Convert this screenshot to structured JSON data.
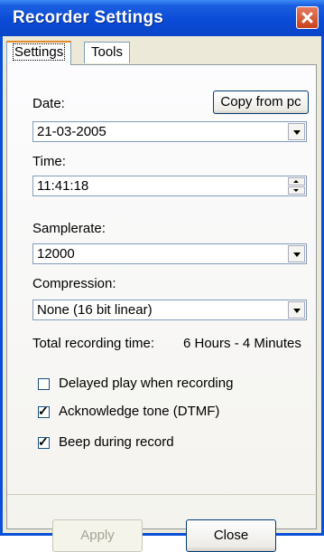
{
  "window": {
    "title": "Recorder Settings"
  },
  "tabs": [
    {
      "label": "Settings",
      "active": true
    },
    {
      "label": "Tools",
      "active": false
    }
  ],
  "date": {
    "label": "Date:",
    "value": "21-03-2005",
    "copy_button": "Copy from pc"
  },
  "time": {
    "label": "Time:",
    "value": "11:41:18"
  },
  "samplerate": {
    "label": "Samplerate:",
    "value": "12000"
  },
  "compression": {
    "label": "Compression:",
    "value": "None (16 bit linear)"
  },
  "recording_time": {
    "label": "Total recording time:",
    "value": "6 Hours - 4 Minutes"
  },
  "options": [
    {
      "label": "Delayed play when recording",
      "checked": false
    },
    {
      "label": "Acknowledge tone (DTMF)",
      "checked": true
    },
    {
      "label": "Beep during record",
      "checked": true
    }
  ],
  "buttons": {
    "apply": "Apply",
    "close": "Close"
  },
  "colors": {
    "title_bar": "#0a4fd8",
    "dialog_face": "#ece9d8",
    "close_button": "#c9431d",
    "active_tab_highlight": "#e68b2c"
  }
}
